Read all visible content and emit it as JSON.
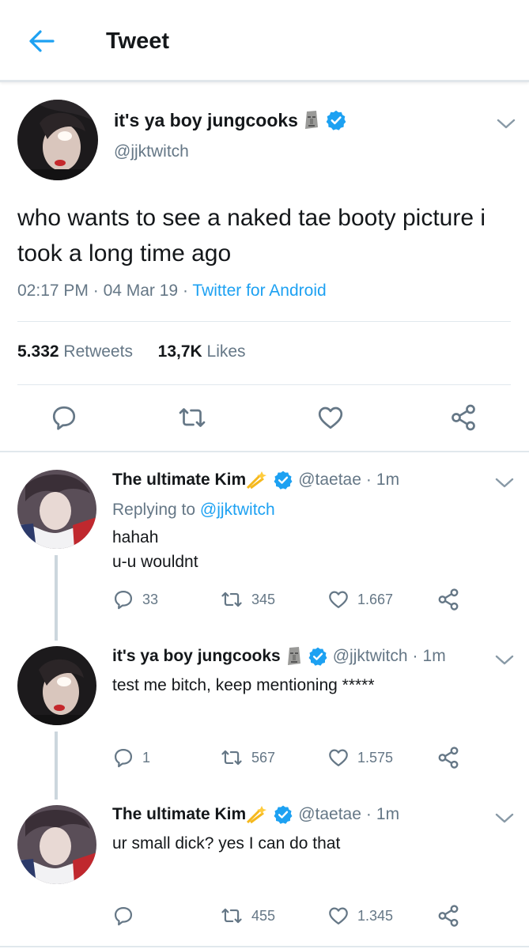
{
  "header": {
    "title": "Tweet"
  },
  "main_tweet": {
    "name": "it's ya boy jungcooks",
    "handle": "@jjktwitch",
    "text": "who wants to see a naked tae booty picture i took a long time ago",
    "time": "02:17 PM",
    "date": "04 Mar 19",
    "source": "Twitter for Android",
    "retweets_count": "5.332",
    "retweets_label": "Retweets",
    "likes_count": "13,7K",
    "likes_label": "Likes"
  },
  "replies": [
    {
      "name": "The ultimate Kim",
      "handle": "@taetae",
      "time": "1m",
      "replying_prefix": "Replying to",
      "replying_to": "@jjktwitch",
      "line1": "hahah",
      "line2": "u-u wouldnt",
      "replies": "33",
      "retweets": "345",
      "likes": "1.667"
    },
    {
      "name": "it's ya boy jungcooks",
      "handle": "@jjktwitch",
      "time": "1m",
      "line1": "test me bitch, keep mentioning *****",
      "replies": "1",
      "retweets": "567",
      "likes": "1.575"
    },
    {
      "name": "The ultimate Kim",
      "handle": "@taetae",
      "time": "1m",
      "line1": "ur small dick? yes I can do that",
      "replies": "",
      "retweets": "455",
      "likes": "1.345"
    }
  ],
  "colors": {
    "accent": "#1da1f2",
    "secondary_text": "#657786",
    "primary_text": "#14171a",
    "divider": "#e1e8ed"
  },
  "icons": [
    "back-arrow-icon",
    "chevron-down-icon",
    "verified-icon",
    "moai-emoji-icon",
    "sparkle-emoji-icon",
    "reply-icon",
    "retweet-icon",
    "like-icon",
    "share-icon"
  ]
}
